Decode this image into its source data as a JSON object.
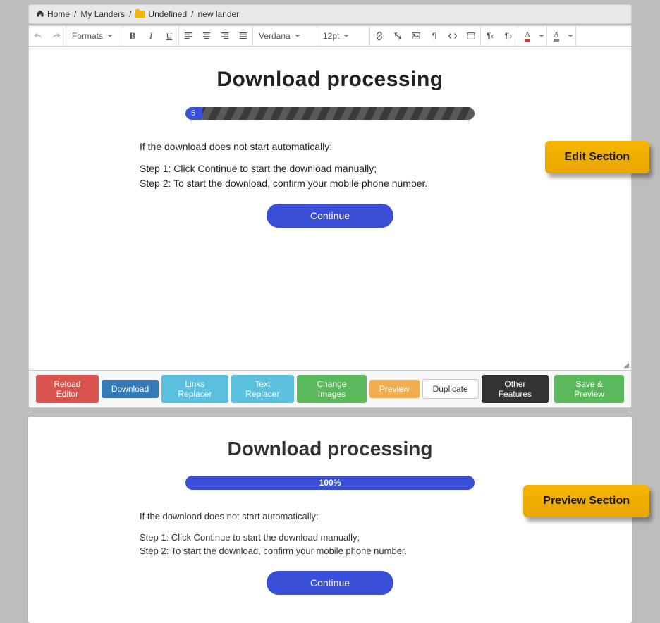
{
  "breadcrumb": {
    "home": "Home",
    "landers": "My Landers",
    "folder": "Undefined",
    "current": "new lander"
  },
  "toolbar": {
    "formats": "Formats",
    "font": "Verdana",
    "size": "12pt",
    "bold": "B",
    "italic": "I",
    "underline": "U",
    "textcolor": "A",
    "bgcolor": "A"
  },
  "editor": {
    "title": "Download processing",
    "progress_value": "5",
    "intro": "If the download does not start automatically:",
    "step1": "Step 1: Click Continue to start the download manually;",
    "step2": "Step 2: To start the download, confirm your mobile phone number.",
    "cta": "Continue"
  },
  "actions": {
    "reload": "Reload Editor",
    "download": "Download",
    "links_replacer": "Links Replacer",
    "text_replacer": "Text Replacer",
    "change_images": "Change Images",
    "preview": "Preview",
    "duplicate": "Duplicate",
    "other": "Other Features",
    "save": "Save & Preview"
  },
  "preview": {
    "title": "Download processing",
    "progress_label": "100%",
    "intro": "If the download does not start automatically:",
    "step1": "Step 1: Click Continue to start the download manually;",
    "step2": "Step 2: To start the download, confirm your mobile phone number.",
    "cta": "Continue"
  },
  "callouts": {
    "edit": "Edit Section",
    "preview": "Preview Section"
  }
}
